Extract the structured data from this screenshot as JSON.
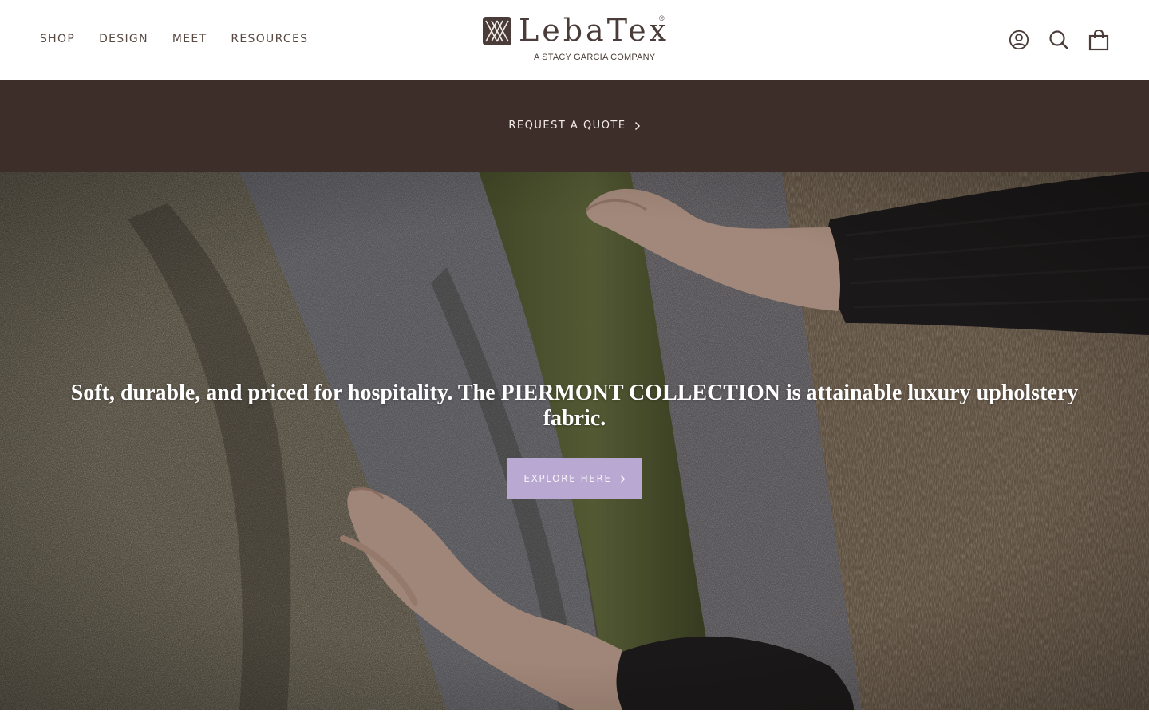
{
  "nav": {
    "items": [
      "SHOP",
      "DESIGN",
      "MEET",
      "RESOURCES"
    ]
  },
  "logo": {
    "wordmark": "LebaTex",
    "registered": "®",
    "subtitle": "A STACY GARCIA COMPANY"
  },
  "header_icons": {
    "account": "account-icon",
    "search": "search-icon",
    "cart": "cart-icon"
  },
  "announcement": {
    "link_label": "REQUEST A QUOTE",
    "background": "#3e2e29"
  },
  "hero": {
    "headline": "Soft, durable, and priced for hospitality. The PIERMONT COLLECTION is attainable luxury upholstery fabric.",
    "button_label": "EXPLORE HERE",
    "button_color": "#b9a8d1"
  },
  "colors": {
    "brand_brown": "#3e2e29",
    "accent_lavender": "#b9a8d1",
    "nav_text": "#5a4a44"
  }
}
